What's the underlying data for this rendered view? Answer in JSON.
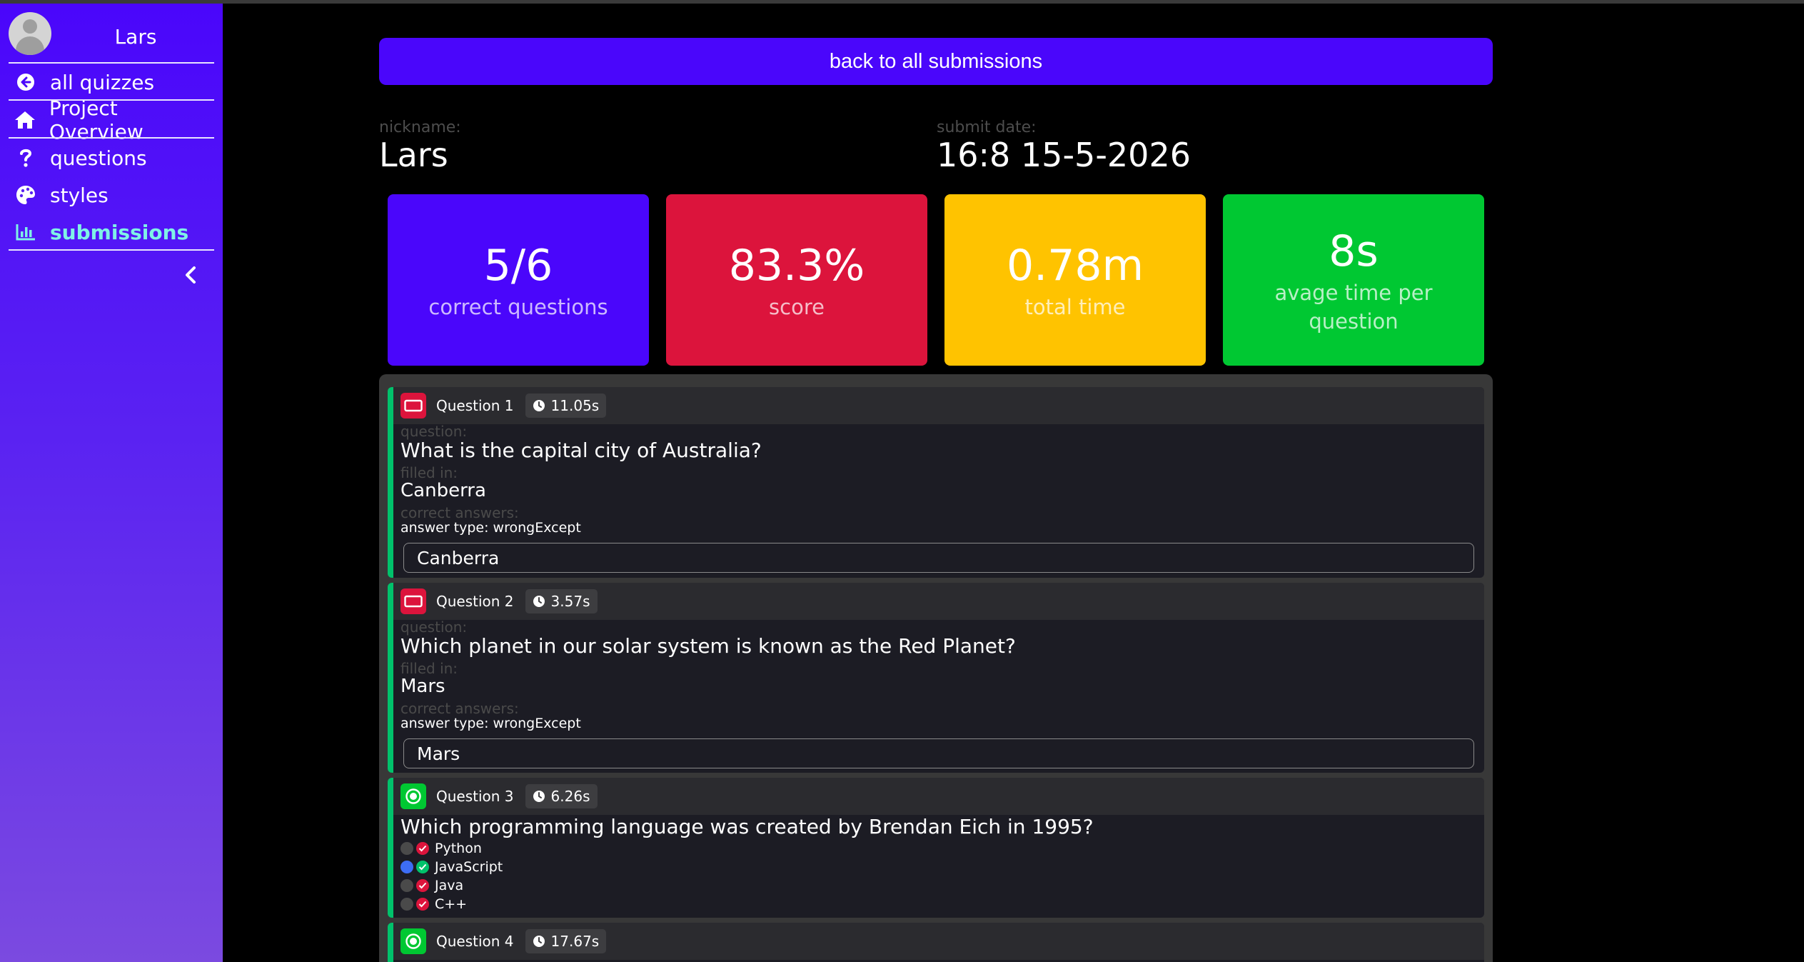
{
  "sidebar": {
    "username": "Lars",
    "items": [
      {
        "label": "all quizzes",
        "icon": "arrow-left-circle-icon"
      },
      {
        "label": "Project Overview",
        "icon": "home-icon"
      },
      {
        "label": "questions",
        "icon": "question-icon"
      },
      {
        "label": "styles",
        "icon": "palette-icon"
      },
      {
        "label": "submissions",
        "icon": "bar-chart-icon",
        "active": true
      }
    ]
  },
  "back_button": "back to all submissions",
  "nickname": {
    "label": "nickname:",
    "value": "Lars"
  },
  "submit_date": {
    "label": "submit date:",
    "value": "16:8 15-5-2026"
  },
  "stats": [
    {
      "value": "5/6",
      "label": "correct questions",
      "color": "#4a06fb"
    },
    {
      "value": "83.3%",
      "label": "score",
      "color": "#dc143c"
    },
    {
      "value": "0.78m",
      "label": "total time",
      "color": "#ffc300"
    },
    {
      "value": "8s",
      "label": "avage time per question",
      "color": "#00c832"
    }
  ],
  "questions": [
    {
      "title": "Question 1",
      "time": "11.05s",
      "icon": "text-input-icon",
      "icon_color": "#dc143c",
      "question_label": "question:",
      "question": "What is the capital city of Australia?",
      "filled_label": "filled in:",
      "filled": "Canberra",
      "correct_label": "correct answers:",
      "answer_type": "answer type: wrongExcept",
      "correct_answer": "Canberra"
    },
    {
      "title": "Question 2",
      "time": "3.57s",
      "icon": "text-input-icon",
      "icon_color": "#dc143c",
      "question_label": "question:",
      "question": "Which planet in our solar system is known as the Red Planet?",
      "filled_label": "filled in:",
      "filled": "Mars",
      "correct_label": "correct answers:",
      "answer_type": "answer type: wrongExcept",
      "correct_answer": "Mars"
    },
    {
      "title": "Question 3",
      "time": "6.26s",
      "icon": "radio-icon",
      "icon_color": "#00c832",
      "question": "Which programming language was created by Brendan Eich in 1995?",
      "options": [
        {
          "label": "Python",
          "selected": false,
          "correct": false
        },
        {
          "label": "JavaScript",
          "selected": true,
          "correct": true
        },
        {
          "label": "Java",
          "selected": false,
          "correct": false
        },
        {
          "label": "C++",
          "selected": false,
          "correct": false
        }
      ]
    },
    {
      "title": "Question 4",
      "time": "17.67s",
      "icon": "radio-icon",
      "icon_color": "#00c832"
    }
  ]
}
